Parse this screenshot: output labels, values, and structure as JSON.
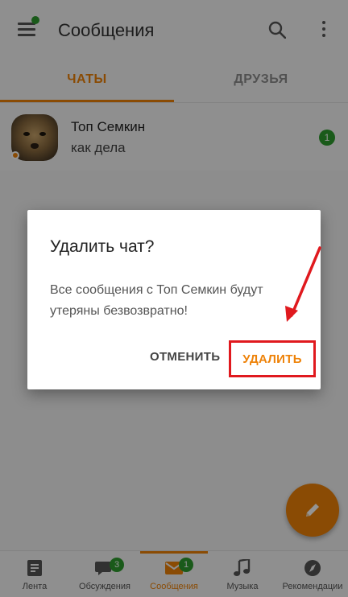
{
  "header": {
    "title": "Сообщения",
    "menu_icon": "hamburger-icon",
    "search_icon": "search-icon",
    "more_icon": "more-vert-icon"
  },
  "tabs": [
    {
      "label": "ЧАТЫ",
      "active": true
    },
    {
      "label": "ДРУЗЬЯ",
      "active": false
    }
  ],
  "chats": [
    {
      "name": "Топ Семкин",
      "preview": "как дела",
      "unread": "1"
    }
  ],
  "dialog": {
    "title": "Удалить чат?",
    "message": "Все сообщения с Топ Семкин будут утеряны безвозвратно!",
    "cancel_label": "ОТМЕНИТЬ",
    "delete_label": "УДАЛИТЬ"
  },
  "bottom_nav": [
    {
      "label": "Лента",
      "icon": "feed-icon",
      "badge": ""
    },
    {
      "label": "Обсуждения",
      "icon": "discussions-icon",
      "badge": "3"
    },
    {
      "label": "Сообщения",
      "icon": "mail-icon",
      "badge": "1",
      "active": true
    },
    {
      "label": "Музыка",
      "icon": "music-icon",
      "badge": ""
    },
    {
      "label": "Рекомендации",
      "icon": "compass-icon",
      "badge": ""
    }
  ],
  "colors": {
    "accent": "#ee8208",
    "badge_green": "#2e9b2e",
    "highlight_red": "#e0191e"
  }
}
